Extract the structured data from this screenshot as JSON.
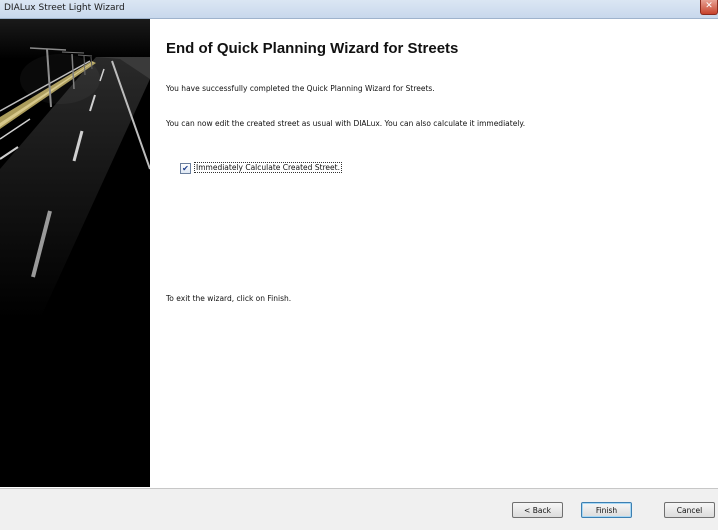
{
  "window": {
    "title": "DIALux Street Light Wizard",
    "close_glyph": "✕"
  },
  "content": {
    "heading": "End of Quick Planning Wizard for Streets",
    "line1": "You have successfully completed the Quick Planning Wizard for Streets.",
    "line2": "You can now edit the created street as usual with DIALux. You can also  calculate it immediately.",
    "checkbox": {
      "label": "Immediately Calculate Created Street.",
      "checked": true,
      "check_glyph": "✔"
    },
    "exit_hint": "To exit the wizard, click on Finish."
  },
  "buttons": {
    "back": "< Back",
    "finish": "Finish",
    "cancel": "Cancel"
  },
  "side_image": {
    "icon": "night-street-image"
  }
}
